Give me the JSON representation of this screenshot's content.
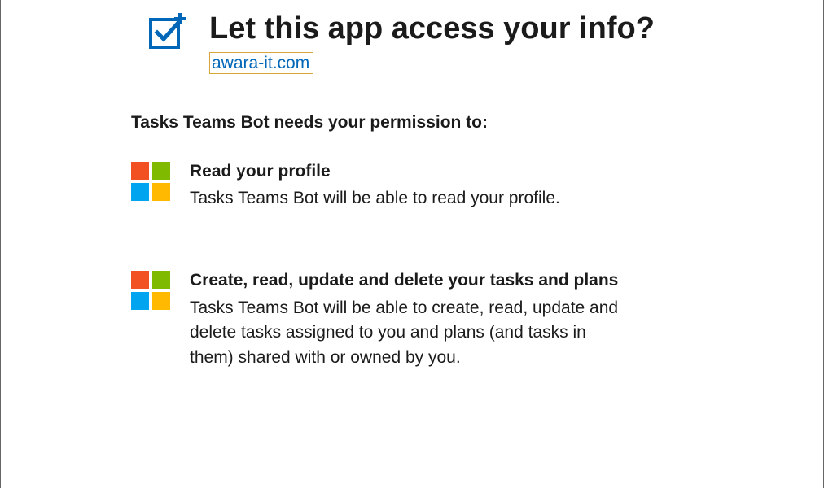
{
  "header": {
    "title": "Let this app access your info?",
    "domain": "awara-it.com"
  },
  "permission_intro": "Tasks Teams Bot needs your permission to:",
  "permissions": [
    {
      "title": "Read your profile",
      "desc": "Tasks Teams Bot will be able to read your profile."
    },
    {
      "title": "Create, read, update and delete your tasks and plans",
      "desc": "Tasks Teams Bot will be able to create, read, update and delete tasks assigned to you and plans (and tasks in them) shared with or owned by you."
    }
  ]
}
